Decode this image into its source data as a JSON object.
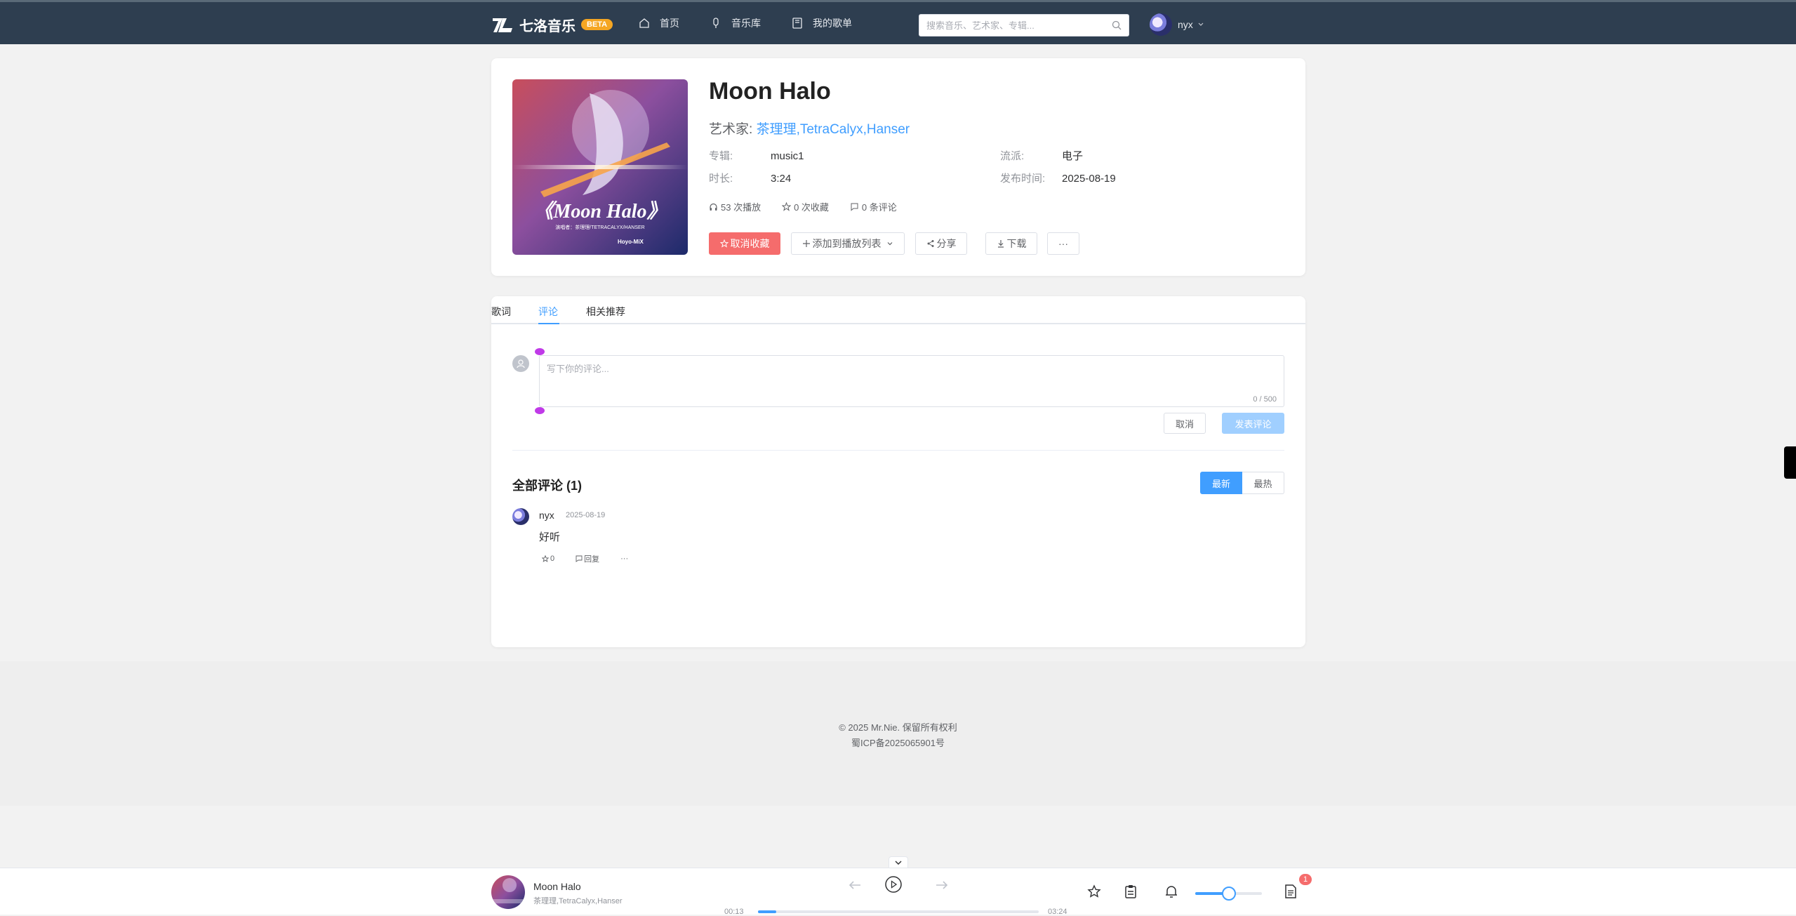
{
  "header": {
    "brand": "七洛音乐",
    "beta": "BETA",
    "nav": [
      {
        "label": "首页",
        "icon": "home-icon"
      },
      {
        "label": "音乐库",
        "icon": "microphone-icon"
      },
      {
        "label": "我的歌单",
        "icon": "playlist-icon"
      }
    ],
    "search_placeholder": "搜索音乐、艺术家、专辑...",
    "user": "nyx"
  },
  "song": {
    "title": "Moon Halo",
    "artist_label": "艺术家:",
    "artists": "茶理理,TetraCalyx,Hanser",
    "album_label": "专辑:",
    "album": "music1",
    "duration_label": "时长:",
    "duration": "3:24",
    "genre_label": "流派:",
    "genre": "电子",
    "release_label": "发布时间:",
    "release": "2025-08-19",
    "plays": "53 次播放",
    "favorites": "0 次收藏",
    "comments": "0 条评论",
    "cover_text": "《Moon Halo》",
    "cover_subtitle": "演唱者：茶理理/TETRACALYX/HANSER",
    "cover_logo": "Hoyo-MiX"
  },
  "actions": {
    "unfavorite": "取消收藏",
    "add_to_playlist": "添加到播放列表",
    "share": "分享",
    "download": "下载",
    "more": "···"
  },
  "tabs": [
    {
      "label": "歌词",
      "active": false
    },
    {
      "label": "评论",
      "active": true
    },
    {
      "label": "相关推荐",
      "active": false
    }
  ],
  "comment_form": {
    "placeholder": "写下你的评论...",
    "counter": "0 / 500",
    "cancel": "取消",
    "submit": "发表评论"
  },
  "comments_section": {
    "title": "全部评论 (1)",
    "sort_latest": "最新",
    "sort_hot": "最热",
    "items": [
      {
        "user": "nyx",
        "date": "2025-08-19",
        "text": "好听",
        "likes": "0",
        "reply": "回复",
        "more": "···"
      }
    ]
  },
  "footer": {
    "copyright": "© 2025 Mr.Nie. 保留所有权利",
    "icp": "蜀ICP备2025065901号"
  },
  "player": {
    "title": "Moon Halo",
    "artist": "茶理理,TetraCalyx,Hanser",
    "current_time": "00:13",
    "total_time": "03:24",
    "progress": 0.064,
    "volume": 0.5,
    "badge": "1"
  },
  "colors": {
    "header_bg": "#2e3e50",
    "accent": "#409eff",
    "danger": "#f56c6c",
    "beta": "#f5a623"
  }
}
